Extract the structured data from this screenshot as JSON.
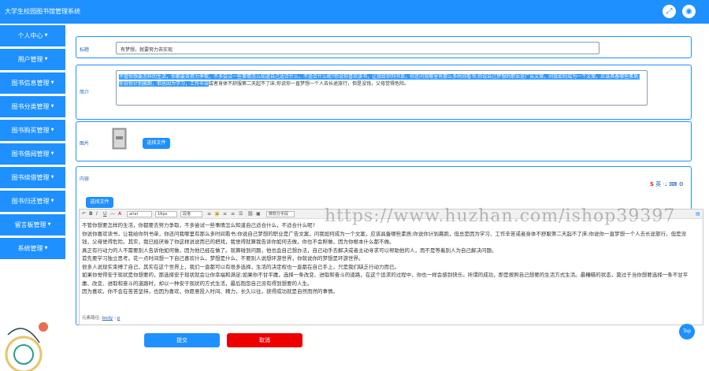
{
  "header": {
    "title": "大学生校园图书馆管理系统",
    "fullscreen_icon": "fullscreen-icon",
    "user_icon": "user-icon"
  },
  "sidebar": {
    "items": [
      {
        "label": "个人中心",
        "caret": "▼"
      },
      {
        "label": "用户管理",
        "caret": "▼"
      },
      {
        "label": "图书信息管理",
        "caret": "▼"
      },
      {
        "label": "图书分类管理",
        "caret": "▼"
      },
      {
        "label": "图书购买管理",
        "caret": "▼"
      },
      {
        "label": "图书借阅管理",
        "caret": "▼"
      },
      {
        "label": "图书续借管理",
        "caret": "▼"
      },
      {
        "label": "图书归还管理",
        "caret": "▼"
      },
      {
        "label": "留言板管理",
        "caret": "▼"
      },
      {
        "label": "系统管理",
        "caret": "▼"
      }
    ]
  },
  "form": {
    "title_label": "标题",
    "title_value": "有梦想，就要努力去实现",
    "intro_label": "简介",
    "intro_selected": "不管你想要怎样的生活，你都要去努力争取，不多尝试一些事情怎么知道自己适合什么，不适合什么呢?你说你喜欢读书，让我给你列书单，你还问我哪里有那么多时间看书;你说自己梦想的职业是广告文案，问我如何成为一个文案，应该具备哪些素质;你说你计划晨跑，但总因为学习，工作辛苦",
    "intro_rest": "或者身体不舒服第二天起不了床;你说你一直梦想一个人去长途旅行，但是没钱，父母觉得危险。",
    "image_label": "图片",
    "upload_label": "选择文件",
    "content_label": "内容",
    "content_upload_label": "选择文件",
    "editor_path_label": "元素路径:",
    "editor_path_items": [
      "body",
      "p"
    ],
    "submit_label": "提交",
    "cancel_label": "取消"
  },
  "editor": {
    "font_family": "arial",
    "font_size": "16px",
    "paragraph": "段落",
    "format": "微软分手段",
    "paragraphs": [
      "不管你想要怎样的生活，你都要去努力争取，不多尝试一些事情怎么知道自己适合什么，不适合什么呢?",
      "你说你喜欢读书，让我给你列书单，你还问我哪里有那么多时间看书;你说自己梦想的职业是广告文案，问我如何成为一个文案，应该具备哪些素质;你说你计划晨跑，但总是因为学习、工作辛苦或者身体不舒服第二天起不了床;你说你一直梦想一个人去长途旅行，但是没钱，父母觉得危险。其实，我已经厌倦了你这样说说而已的把戏，我觉得就算我告诉你如何去做，你也不会照做，因为你根本什么都不做。",
      "真正有行动力的人不需要别人告诉他如何做，因为他已经在做了。就算碰到问题，他也会自己想办法，自己动手去解决或者主动寻求可以帮助他的人，而不是等着别人为自己解决问题。",
      "首先要学习独立思考。花一点时间想一下自己喜欢什么，梦想是什么，不要别人说想环游世界，你就说你的梦想是环游世界。",
      "很多人说现实束缚了自己，其实在这个世界上，我们一直都可以有很多选择，生活的决定权也一直都在自己手上，只是我们缺乏行动力而已。",
      "如果你觉得安于现状是你想要的，那选择安于现状就会让你幸福和满足;如果你不甘平庸，选择一条改变、进取和奋斗的道路，在这个追求的过程中，你也一样会感到快乐。所谓的成功，即是按照自己想要的生活方式生活。最糟糕的状态，莫过于当你想要选择一条不甘平庸、改变、进取和奋斗的道路时，却以一种安于现状的方式生活，最后抱怨自己没有得到想要的人生。",
      "因为喜欢，你不会在苦苦坚持，也因为喜欢，你愿意投入时间、精力，长久以往，获得成功就是自然而然的事情。"
    ]
  },
  "overlay": {
    "watermark": "https://www.huzhan.com/ishop39397",
    "ime_label": "英",
    "top_label": "Top"
  }
}
